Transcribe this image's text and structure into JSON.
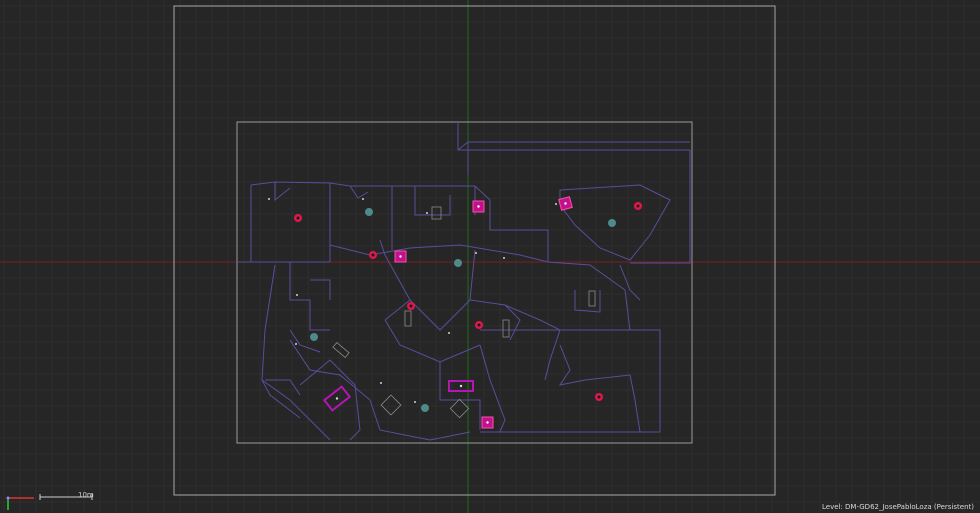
{
  "viewport": {
    "mode": "top-orthographic",
    "background_color": "#262626",
    "grid_color": "#2f2f2f",
    "origin_x_axis_color": "#7a1f1f",
    "origin_y_axis_color": "#1f6b1f",
    "wireframe_color": "#5a4d9c",
    "bounds_color": "#a8a8a8"
  },
  "scale_bar": {
    "label": "10m"
  },
  "status": {
    "level_text": "Level:  DM-GD62_JosePabloLoza (Persistent)"
  },
  "actor_colors": {
    "pickup": "#e0174c",
    "selected": "#c0128a",
    "player_start": "#4f8a8a"
  },
  "icons": {
    "gizmo": "axis-gizmo-icon",
    "pickup": "pickup-icon",
    "player_start": "player-start-icon",
    "selected_actor": "selected-actor-icon"
  }
}
